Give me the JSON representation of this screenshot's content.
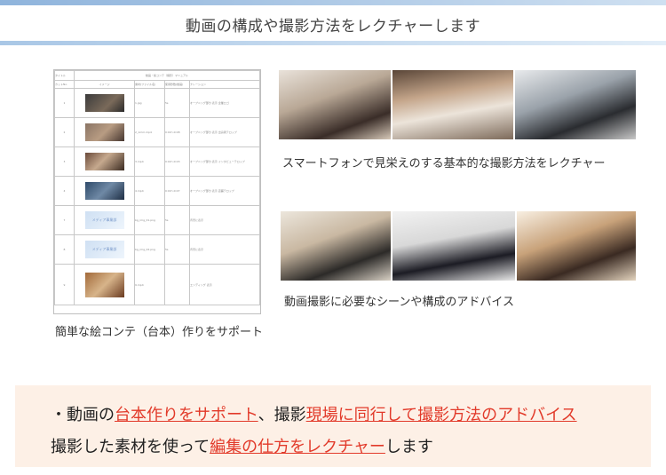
{
  "header": {
    "title": "動画の構成や撮影方法をレクチャーします"
  },
  "storyboard": {
    "title": "動画・絵コンテ（撮影）マニュアル",
    "columns": [
      "カットNo.",
      "イメージ",
      "素材(ファイル名)",
      "使用秒数(動画)",
      "ナレーション"
    ],
    "rows": [
      {
        "no": "1",
        "file": "1.jpg",
        "secs": "5s",
        "note": "オープニング部分 表示 企業ロゴ"
      },
      {
        "no": "2",
        "file": "2_1mm.mp4",
        "secs": "0:00～0:08",
        "note": "オープニング部分 表示 出演者テロップ"
      },
      {
        "no": "3",
        "file": "3.mp4",
        "secs": "0:00～0:03",
        "note": "オープニング部分 表示 インタビューテロップ"
      },
      {
        "no": "4",
        "file": "4.mp4",
        "secs": "0:00～0:07",
        "note": "オープニング部分 表示 店舗テロップ"
      },
      {
        "no": "7",
        "file": "bg_img_01.png",
        "secs": "5s",
        "image_text": "メディア事業部",
        "note": "背景に表示"
      },
      {
        "no": "8",
        "file": "bg_img_02.png",
        "secs": "5s",
        "image_text": "メディア事業部",
        "note": "背景に表示"
      },
      {
        "no": "9",
        "file": "9.mp4",
        "secs": "",
        "note": "エンディング 表示"
      }
    ]
  },
  "captions": {
    "storyboard": "簡単な絵コンテ（台本）作りをサポート",
    "smartphone": "スマートフォンで見栄えのする基本的な撮影方法をレクチャー",
    "scenes": "動画撮影に必要なシーンや構成のアドバイス"
  },
  "notes": {
    "line1": {
      "prefix": "・動画の",
      "hl1": "台本作りをサポート",
      "mid": "、撮影",
      "hl2": "現場に同行して撮影方法のアドバイス"
    },
    "line2": {
      "prefix": "撮影した素材を使って",
      "hl1": "編集の仕方をレクチャー",
      "suffix": "します"
    }
  },
  "colors": {
    "accent_red": "#e23a2a",
    "note_bg": "#fdf0e6",
    "header_rule": "#a9c7e6"
  }
}
